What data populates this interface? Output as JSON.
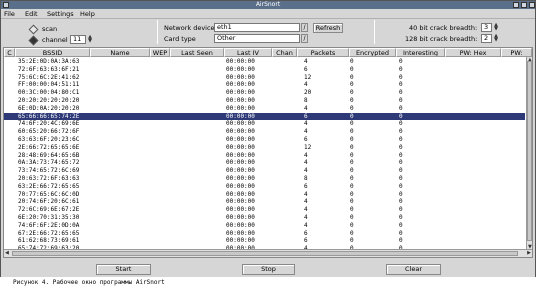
{
  "window": {
    "title": "AirSnort"
  },
  "menu": [
    {
      "label": "File"
    },
    {
      "label": "Edit"
    },
    {
      "label": "Settings"
    },
    {
      "label": "Help"
    }
  ],
  "controls": {
    "scan_label": "scan",
    "channel_label": "channel",
    "channel_value": "11",
    "network_device_label": "Network device",
    "network_device_value": "eth1",
    "refresh_label": "Refresh",
    "card_type_label": "Card type",
    "card_type_value": "Other",
    "crack40_label": "40 bit crack breadth:",
    "crack40_value": "3",
    "crack128_label": "128 bit crack breadth:",
    "crack128_value": "2"
  },
  "table": {
    "columns": [
      "C",
      "BSSID",
      "Name",
      "WEP",
      "Last Seen",
      "Last IV",
      "Chan",
      "Packets",
      "Encrypted",
      "Interesting",
      "PW: Hex",
      "PW:"
    ],
    "rows": [
      {
        "bssid": "35:2E:0D:0A:3A:63",
        "last_iv": "00:00:00",
        "chan": "",
        "packets": "4",
        "encrypted": "0",
        "interesting": "0",
        "selected": false
      },
      {
        "bssid": "72:6F:63:63:6F:21",
        "last_iv": "00:00:00",
        "chan": "",
        "packets": "6",
        "encrypted": "0",
        "interesting": "0",
        "selected": false
      },
      {
        "bssid": "75:6C:6C:2E:41:62",
        "last_iv": "00:00:00",
        "chan": "",
        "packets": "12",
        "encrypted": "0",
        "interesting": "0",
        "selected": false
      },
      {
        "bssid": "FF:00:00:04:51:11",
        "last_iv": "00:00:00",
        "chan": "",
        "packets": "4",
        "encrypted": "0",
        "interesting": "0",
        "selected": false
      },
      {
        "bssid": "00:3C:00:04:80:C1",
        "last_iv": "00:00:00",
        "chan": "",
        "packets": "20",
        "encrypted": "0",
        "interesting": "0",
        "selected": false
      },
      {
        "bssid": "20:20:20:20:20:20",
        "last_iv": "00:00:00",
        "chan": "",
        "packets": "8",
        "encrypted": "0",
        "interesting": "0",
        "selected": false
      },
      {
        "bssid": "6E:0D:0A:20:20:20",
        "last_iv": "00:00:00",
        "chan": "",
        "packets": "4",
        "encrypted": "0",
        "interesting": "0",
        "selected": false
      },
      {
        "bssid": "65:66:66:65:74:2E",
        "last_iv": "00:00:00",
        "chan": "",
        "packets": "6",
        "encrypted": "0",
        "interesting": "0",
        "selected": true
      },
      {
        "bssid": "74:6F:20:4C:69:6E",
        "last_iv": "00:00:00",
        "chan": "",
        "packets": "4",
        "encrypted": "0",
        "interesting": "0",
        "selected": false
      },
      {
        "bssid": "60:65:20:66:72:6F",
        "last_iv": "00:00:00",
        "chan": "",
        "packets": "4",
        "encrypted": "0",
        "interesting": "0",
        "selected": false
      },
      {
        "bssid": "63:63:6F:20:23:6C",
        "last_iv": "00:00:00",
        "chan": "",
        "packets": "6",
        "encrypted": "0",
        "interesting": "0",
        "selected": false
      },
      {
        "bssid": "2E:66:72:65:65:6E",
        "last_iv": "00:00:00",
        "chan": "",
        "packets": "12",
        "encrypted": "0",
        "interesting": "0",
        "selected": false
      },
      {
        "bssid": "28:48:69:64:65:6B",
        "last_iv": "00:00:00",
        "chan": "",
        "packets": "4",
        "encrypted": "0",
        "interesting": "0",
        "selected": false
      },
      {
        "bssid": "0A:3A:73:74:65:72",
        "last_iv": "00:00:00",
        "chan": "",
        "packets": "4",
        "encrypted": "0",
        "interesting": "0",
        "selected": false
      },
      {
        "bssid": "73:74:65:72:6C:69",
        "last_iv": "00:00:00",
        "chan": "",
        "packets": "4",
        "encrypted": "0",
        "interesting": "0",
        "selected": false
      },
      {
        "bssid": "20:63:72:6F:63:63",
        "last_iv": "00:00:00",
        "chan": "",
        "packets": "8",
        "encrypted": "0",
        "interesting": "0",
        "selected": false
      },
      {
        "bssid": "63:2E:66:72:65:65",
        "last_iv": "00:00:00",
        "chan": "",
        "packets": "6",
        "encrypted": "0",
        "interesting": "0",
        "selected": false
      },
      {
        "bssid": "70:77:65:6C:6C:0D",
        "last_iv": "00:00:00",
        "chan": "",
        "packets": "4",
        "encrypted": "0",
        "interesting": "0",
        "selected": false
      },
      {
        "bssid": "20:74:6F:20:6C:61",
        "last_iv": "00:00:00",
        "chan": "",
        "packets": "4",
        "encrypted": "0",
        "interesting": "0",
        "selected": false
      },
      {
        "bssid": "72:6C:69:6E:67:2E",
        "last_iv": "00:00:00",
        "chan": "",
        "packets": "4",
        "encrypted": "0",
        "interesting": "0",
        "selected": false
      },
      {
        "bssid": "6E:20:70:31:35:30",
        "last_iv": "00:00:00",
        "chan": "",
        "packets": "4",
        "encrypted": "0",
        "interesting": "0",
        "selected": false
      },
      {
        "bssid": "74:6F:6F:2E:0D:0A",
        "last_iv": "00:00:00",
        "chan": "",
        "packets": "4",
        "encrypted": "0",
        "interesting": "0",
        "selected": false
      },
      {
        "bssid": "67:2E:66:72:65:65",
        "last_iv": "00:00:00",
        "chan": "",
        "packets": "6",
        "encrypted": "0",
        "interesting": "0",
        "selected": false
      },
      {
        "bssid": "61:62:68:73:69:61",
        "last_iv": "00:00:00",
        "chan": "",
        "packets": "6",
        "encrypted": "0",
        "interesting": "0",
        "selected": false
      },
      {
        "bssid": "65:74:72:69:63:20",
        "last_iv": "00:00:00",
        "chan": "",
        "packets": "4",
        "encrypted": "0",
        "interesting": "0",
        "selected": false
      },
      {
        "bssid": "61:76:65:20:6F:6E",
        "last_iv": "00:00:00",
        "chan": "",
        "packets": "14",
        "encrypted": "0",
        "interesting": "0",
        "selected": false
      },
      {
        "bssid": "69:76:65:43:44:20",
        "last_iv": "00:00:00",
        "chan": "",
        "packets": "8",
        "encrypted": "0",
        "interesting": "0",
        "selected": false
      }
    ]
  },
  "buttons": {
    "start": "Start",
    "stop": "Stop",
    "clear": "Clear"
  },
  "caption": "Рисунок 4. Рабочее окно программы AirSnort",
  "colors": {
    "selected_row": "#2e3a78",
    "titlebar": "#5a6f8a",
    "window_bg": "#d6d6d6"
  }
}
